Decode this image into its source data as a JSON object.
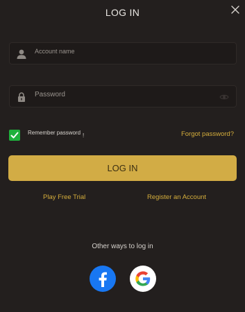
{
  "dialog": {
    "title": "LOG IN",
    "close_icon": "close-icon"
  },
  "form": {
    "account": {
      "placeholder": "Account name",
      "icon": "user-icon"
    },
    "password": {
      "placeholder": "Password",
      "icon": "lock-icon",
      "toggle_icon": "eye-icon"
    },
    "remember": {
      "label": "Remember password",
      "checked": true,
      "info_mark": "!"
    },
    "forgot_label": "Forgot password?",
    "submit_label": "LOG IN"
  },
  "links": {
    "trial": "Play Free Trial",
    "register": "Register an Account"
  },
  "social": {
    "heading": "Other ways to log in",
    "providers": [
      "facebook-icon",
      "google-icon"
    ]
  },
  "colors": {
    "background": "#231f1e",
    "accent": "#d4ad3c",
    "button": "#d2ac45",
    "checkbox": "#1fb13c",
    "facebook": "#1877f2"
  }
}
